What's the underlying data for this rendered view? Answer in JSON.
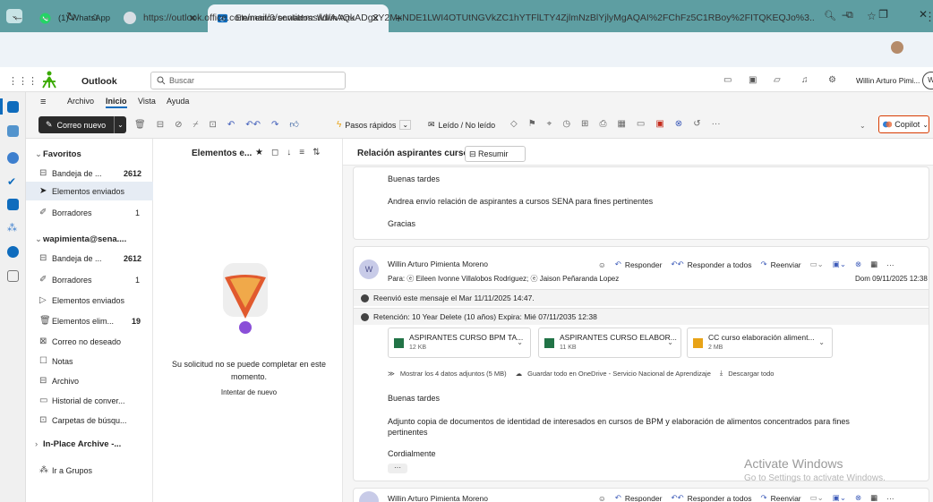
{
  "browser": {
    "tabs": [
      {
        "label": "(1) WhatsApp",
        "icon": "whatsapp-icon"
      },
      {
        "label": "Elementos enviados: Willin Artu",
        "icon": "outlook-icon"
      }
    ],
    "url": "https://outlook.office.com/mail/0/sentitems/id/AAQkADg2Y2MxNDE1LWI4OTUtNGVkZC1hYTFlLTY4ZjlmNzBlYjlyMgAQAI%2FChFz5C1RBoy%2FITQKEQJo%3..."
  },
  "header": {
    "app_name": "Outlook",
    "search_placeholder": "Buscar",
    "user_name": "Willin Arturo Pimi...",
    "avatar_initial": "W"
  },
  "ribbon": {
    "menu": [
      "Archivo",
      "Inicio",
      "Vista",
      "Ayuda"
    ],
    "new_mail": "Correo nuevo",
    "quick_steps": "Pasos rápidos",
    "read_unread": "Leído / No leído",
    "copilot": "Copilot"
  },
  "folders": {
    "favorites_label": "Favoritos",
    "favorites": [
      {
        "label": "Bandeja de ...",
        "count": "2612",
        "icon": "inbox-icon"
      },
      {
        "label": "Elementos enviados",
        "count": "",
        "icon": "sent-icon"
      },
      {
        "label": "Borradores",
        "count": "1",
        "icon": "drafts-icon"
      }
    ],
    "account_label": "wapimienta@sena....",
    "account": [
      {
        "label": "Bandeja de ...",
        "count": "2612",
        "icon": "inbox-icon"
      },
      {
        "label": "Borradores",
        "count": "1",
        "icon": "drafts-icon"
      },
      {
        "label": "Elementos enviados",
        "count": "",
        "icon": "sent-icon"
      },
      {
        "label": "Elementos elim...",
        "count": "19",
        "icon": "trash-icon"
      },
      {
        "label": "Correo no deseado",
        "count": "",
        "icon": "junk-icon"
      },
      {
        "label": "Notas",
        "count": "",
        "icon": "notes-icon"
      },
      {
        "label": "Archivo",
        "count": "",
        "icon": "archive-icon"
      },
      {
        "label": "Historial de conver...",
        "count": "",
        "icon": "folder-icon"
      },
      {
        "label": "Carpetas de búsqu...",
        "count": "",
        "icon": "search-folder-icon"
      }
    ],
    "inplace_label": "In-Place Archive -...",
    "groups_label": "Ir a Grupos"
  },
  "message_list": {
    "title": "Elementos e...",
    "error_text": "Su solicitud no se puede completar en este momento.",
    "retry_text": "Intentar de nuevo"
  },
  "reading": {
    "subject": "Relación aspirantes cursos",
    "summarize": "Resumir",
    "msg1": {
      "greeting": "Buenas tardes",
      "body": "Andrea envío relación de aspirantes a cursos SENA para fines pertinentes",
      "closing": "Gracias"
    },
    "msg2": {
      "sender": "Willin Arturo Pimienta Moreno",
      "to": "Para: ⓔ Eileen Ivonne Villalobos Rodriguez; ⓔ Jaison Peñaranda Lopez",
      "date": "Dom 09/11/2025 12:38",
      "avatar": "W",
      "notice1": "Reenvió este mensaje el Mar 11/11/2025 14:47.",
      "notice2": "Retención: 10 Year Delete (10 años) Expira: Mié 07/11/2035 12:38",
      "attachments": [
        {
          "name": "ASPIRANTES CURSO BPM TA...",
          "size": "12 KB",
          "color": "#217346"
        },
        {
          "name": "ASPIRANTES CURSO ELABOR...",
          "size": "11 KB",
          "color": "#217346"
        },
        {
          "name": "CC curso elaboración aliment...",
          "size": "2 MB",
          "color": "#e8a317"
        }
      ],
      "attach_show": "Mostrar los 4 datos adjuntos (5 MB)",
      "attach_save": "Guardar todo en OneDrive - Servicio Nacional de Aprendizaje",
      "attach_download": "Descargar todo",
      "greeting": "Buenas tardes",
      "body": "Adjunto copia de documentos de identidad de interesados en cursos de BPM y elaboración de alimentos concentrados para fines pertinentes",
      "closing": "Cordialmente",
      "more": "···"
    },
    "msg3": {
      "sender": "Willin Arturo Pimienta Moreno"
    },
    "actions": {
      "reply": "Responder",
      "reply_all": "Responder a todos",
      "forward": "Reenviar"
    }
  },
  "watermark": {
    "line1": "Activate Windows",
    "line2": "Go to Settings to activate Windows."
  },
  "colors": {
    "accent": "#0f6cbd",
    "tab_bar": "#5e9ea2",
    "copilot_border": "#d83b01"
  }
}
